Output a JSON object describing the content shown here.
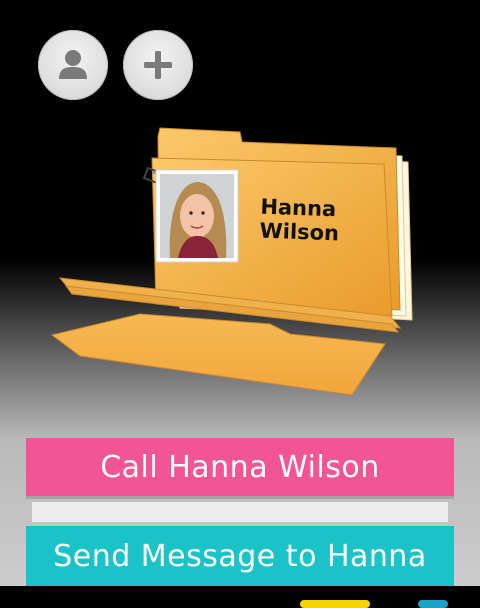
{
  "toolbar": {
    "contacts_icon": "person-icon",
    "add_icon": "plus-icon"
  },
  "contact": {
    "first_name": "Hanna",
    "last_name": "Wilson"
  },
  "actions": {
    "call_label": "Call Hanna Wilson",
    "message_label": "Send Message to Hanna"
  },
  "colors": {
    "call": "#f25494",
    "message": "#19c3c8",
    "folder": "#f7b24a"
  }
}
